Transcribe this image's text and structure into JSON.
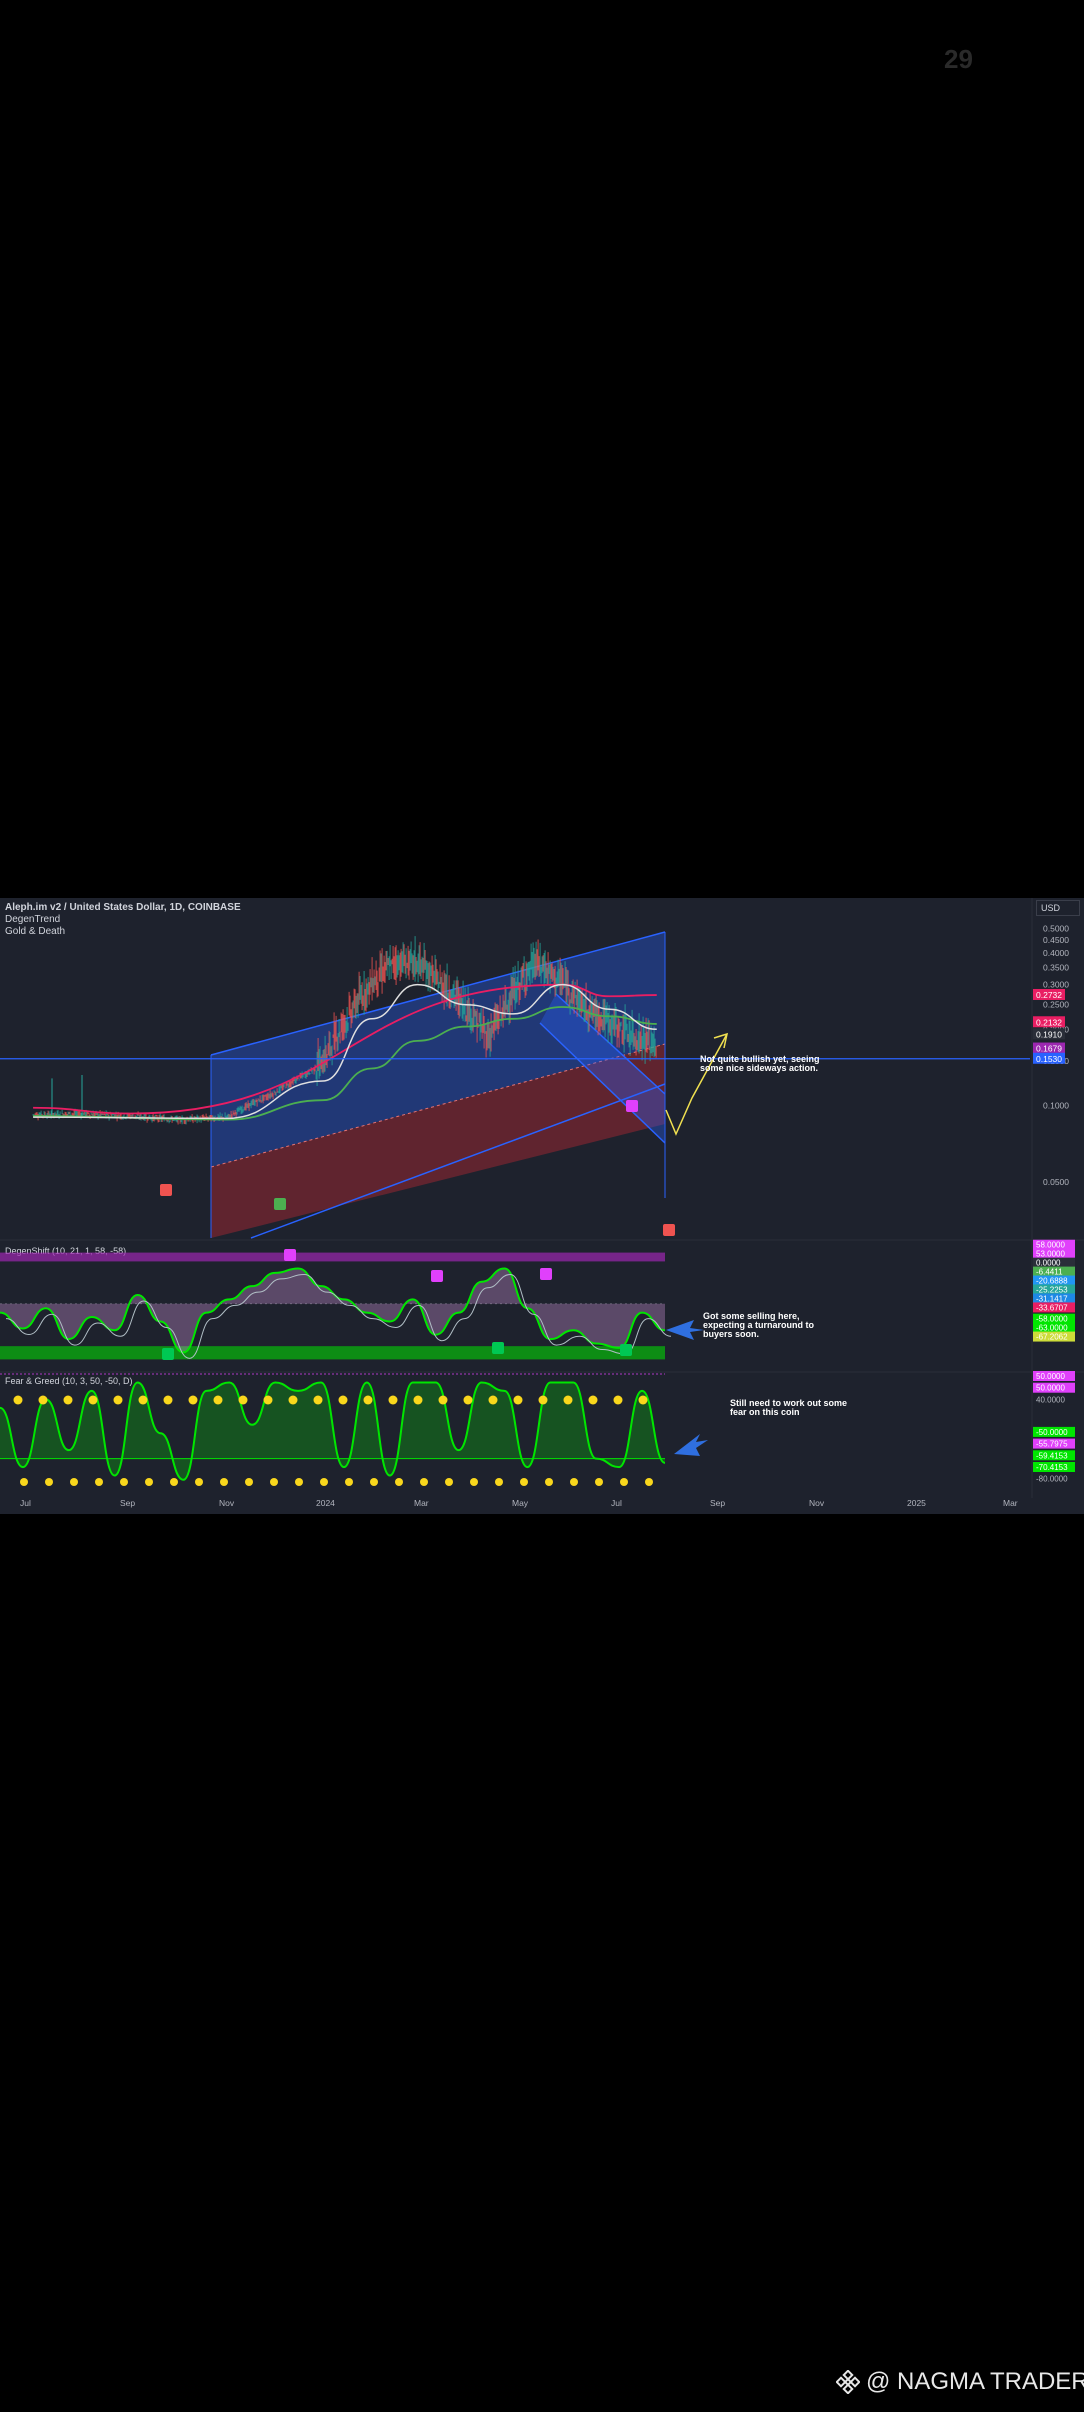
{
  "page_number": "29",
  "watermark": {
    "text": "@ NAGMA TRADER",
    "icon": "binance-logo-icon"
  },
  "header": {
    "symbol": "Aleph.im v2 / United States Dollar, 1D, COINBASE",
    "indicators": [
      "DegenTrend",
      "Gold & Death"
    ],
    "currency": "USD"
  },
  "colors": {
    "background": "#1e222d",
    "up_candle": "#26a69a",
    "down_candle": "#ef5350",
    "channel_blue": "#2962ff",
    "channel_red": "#b22833",
    "ma_white": "#e0e0e0",
    "ma_green": "#4caf50",
    "ma_pink": "#e91e63",
    "oscillator_green": "#00e600",
    "oscillator_purple": "#9c27b0",
    "annotation_arrow_yellow": "#f0e050",
    "annotation_arrow_blue": "#2f6fe0"
  },
  "annotations": [
    {
      "line1": "Not quite bullish yet, seeing",
      "line2": "some nice sideways action."
    },
    {
      "line1": "Got some selling here,",
      "line2": "expecting a turnaround to",
      "line3": "buyers soon."
    },
    {
      "line1": "Still need to work out some",
      "line2": "fear on this coin"
    }
  ],
  "chart_data": [
    {
      "type": "candlestick",
      "pane": "price",
      "title": "Aleph.im v2 / United States Dollar, 1D, COINBASE",
      "y_scale": "log",
      "ylim": [
        0.03,
        0.55
      ],
      "y_ticks": [
        "0.5000",
        "0.4500",
        "0.4000",
        "0.3500",
        "0.3000",
        "0.2500",
        "0.2000",
        "0.1500",
        "0.1000",
        "0.0500"
      ],
      "price_labels": [
        {
          "value": "0.2732",
          "color": "#e91e63"
        },
        {
          "value": "0.2132",
          "color": "#e91e63"
        },
        {
          "value": "0.1910",
          "color": "#2a2e39"
        },
        {
          "value": "0.1679",
          "color": "#9c27b0"
        },
        {
          "value": "0.1530",
          "color": "#2962ff"
        }
      ],
      "horizontal_line": 0.153,
      "x_ticks": [
        "Jul",
        "Sep",
        "Nov",
        "2024",
        "Mar",
        "May",
        "Jul",
        "Sep",
        "Nov",
        "2025",
        "Mar"
      ],
      "price_path": [
        [
          "2023-07-01",
          0.092
        ],
        [
          "2023-08-01",
          0.093
        ],
        [
          "2023-09-01",
          0.091
        ],
        [
          "2023-10-01",
          0.088
        ],
        [
          "2023-11-01",
          0.09
        ],
        [
          "2023-12-01",
          0.112
        ],
        [
          "2024-01-01",
          0.145
        ],
        [
          "2024-01-20",
          0.235
        ],
        [
          "2024-02-01",
          0.3
        ],
        [
          "2024-02-15",
          0.36
        ],
        [
          "2024-03-01",
          0.36
        ],
        [
          "2024-03-15",
          0.3
        ],
        [
          "2024-04-01",
          0.24
        ],
        [
          "2024-04-15",
          0.18
        ],
        [
          "2024-05-01",
          0.27
        ],
        [
          "2024-05-15",
          0.36
        ],
        [
          "2024-06-01",
          0.3
        ],
        [
          "2024-06-15",
          0.24
        ],
        [
          "2024-07-01",
          0.21
        ],
        [
          "2024-07-15",
          0.185
        ],
        [
          "2024-07-31",
          0.17
        ]
      ],
      "ma_white": [
        [
          "2023-07-01",
          0.09
        ],
        [
          "2023-11-01",
          0.089
        ],
        [
          "2024-01-01",
          0.125
        ],
        [
          "2024-02-01",
          0.22
        ],
        [
          "2024-03-01",
          0.3
        ],
        [
          "2024-04-01",
          0.25
        ],
        [
          "2024-05-01",
          0.23
        ],
        [
          "2024-06-01",
          0.3
        ],
        [
          "2024-07-01",
          0.24
        ],
        [
          "2024-07-31",
          0.2
        ]
      ],
      "ma_green": [
        [
          "2023-07-01",
          0.091
        ],
        [
          "2023-11-01",
          0.088
        ],
        [
          "2024-01-01",
          0.105
        ],
        [
          "2024-02-01",
          0.14
        ],
        [
          "2024-03-01",
          0.18
        ],
        [
          "2024-04-01",
          0.205
        ],
        [
          "2024-05-01",
          0.22
        ],
        [
          "2024-06-01",
          0.245
        ],
        [
          "2024-07-01",
          0.225
        ],
        [
          "2024-07-31",
          0.21
        ]
      ],
      "ma_pink": [
        [
          "2023-07-01",
          0.098
        ],
        [
          "2023-09-01",
          0.093
        ],
        [
          "2024-06-01",
          0.3
        ],
        [
          "2024-07-01",
          0.27
        ],
        [
          "2024-07-31",
          0.273
        ]
      ]
    },
    {
      "type": "line",
      "pane": "oscillator",
      "title": "DegenShift (10, 21, 1, 58, -58)",
      "ylim": [
        -75,
        70
      ],
      "value_labels": [
        {
          "value": "58.0000",
          "color": "#e040fb"
        },
        {
          "value": "53.0000",
          "color": "#e040fb"
        },
        {
          "value": "0.0000",
          "color": "#2a2e39"
        },
        {
          "value": "-6.4411",
          "color": "#4caf50"
        },
        {
          "value": "-20.6888",
          "color": "#2196f3"
        },
        {
          "value": "-25.2253",
          "color": "#26a69a"
        },
        {
          "value": "-31.1417",
          "color": "#1e88e5"
        },
        {
          "value": "-33.6707",
          "color": "#e91e63"
        },
        {
          "value": "-58.0000",
          "color": "#00e600"
        },
        {
          "value": "-63.0000",
          "color": "#00e600"
        },
        {
          "value": "-67.2062",
          "color": "#cddc39"
        }
      ],
      "series": [
        {
          "name": "",
          "values": [
            -10,
            -28,
            -5,
            -40,
            -15,
            -30,
            10,
            -20,
            -55,
            -10,
            5,
            20,
            35,
            40,
            20,
            5,
            -10,
            -20,
            5,
            -35,
            -10,
            25,
            40,
            -5,
            -40,
            -30,
            -45,
            -50,
            -10,
            -30
          ]
        }
      ]
    },
    {
      "type": "line",
      "pane": "fear-greed",
      "title": "Fear & Greed (10, 3, 50, -50, D)",
      "ylim": [
        -80,
        50
      ],
      "value_labels": [
        {
          "value": "50.0000",
          "color": "#e040fb"
        },
        {
          "value": "50.0000",
          "color": "#e040fb"
        },
        {
          "value": "40.0000",
          "color": "#1e222d"
        },
        {
          "value": "-50.0000",
          "color": "#00e600"
        },
        {
          "value": "-55.7975",
          "color": "#e040fb"
        },
        {
          "value": "-59.4153",
          "color": "#00e600"
        },
        {
          "value": "-70.4153",
          "color": "#00e600"
        },
        {
          "value": "-80.0000",
          "color": "#1e222d"
        }
      ],
      "series": [
        {
          "name": "",
          "values": [
            10,
            -60,
            20,
            -40,
            30,
            -70,
            40,
            -20,
            -75,
            30,
            40,
            -10,
            40,
            30,
            40,
            -60,
            40,
            -70,
            40,
            40,
            -40,
            40,
            30,
            -60,
            40,
            40,
            -50,
            -60,
            30,
            -55
          ]
        }
      ]
    }
  ]
}
